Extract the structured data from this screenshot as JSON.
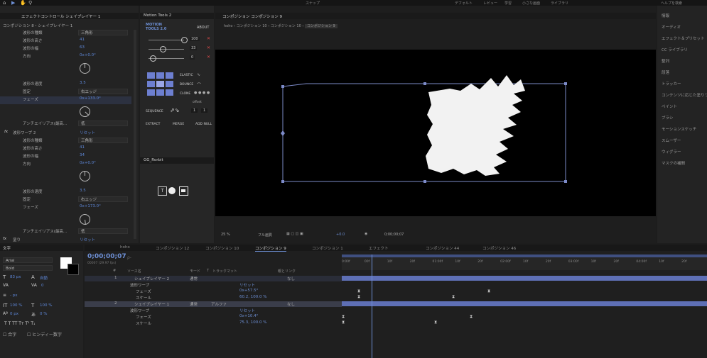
{
  "top_toolbar": {
    "left_icons": [
      "home-icon",
      "select-arrow-icon",
      "hand-icon",
      "zoom-icon"
    ],
    "mid_label": "スナップ",
    "right_tabs": [
      "デフォルト",
      "レビュー",
      "学習",
      "小さな画面",
      "ライブラリ"
    ],
    "search_placeholder": "ヘルプを検索"
  },
  "effects_panel": {
    "tab_label": "エフェクトコントロール シェイプレイヤー 1",
    "subtitle": "コンポジション 8・シェイプレイヤー 1",
    "group1": [
      {
        "label": "波形の種類",
        "value": "三角形",
        "type": "dropdown"
      },
      {
        "label": "波形の高さ",
        "value": "41",
        "type": "value"
      },
      {
        "label": "波形の幅",
        "value": "63",
        "type": "value"
      },
      {
        "label": "方向",
        "value": "0x+0.0°",
        "type": "value"
      }
    ],
    "group1b": [
      {
        "label": "波形の速度",
        "value": "3.5",
        "type": "value"
      },
      {
        "label": "固定",
        "value": "右エッジ",
        "type": "dropdown"
      },
      {
        "label": "フェーズ",
        "value": "0x+133.0°",
        "type": "value"
      }
    ],
    "aa1": {
      "label": "アンチエイリアス(最高...",
      "value": "低"
    },
    "fx_title": "波形ワープ 2",
    "fx_reset": "リセット",
    "group2": [
      {
        "label": "波形の種類",
        "value": "三角形",
        "type": "dropdown"
      },
      {
        "label": "波形の高さ",
        "value": "41",
        "type": "value"
      },
      {
        "label": "波形の幅",
        "value": "34",
        "type": "value"
      },
      {
        "label": "方向",
        "value": "0x+0.0°",
        "type": "value"
      }
    ],
    "group2b": [
      {
        "label": "波形の速度",
        "value": "3.5",
        "type": "value"
      },
      {
        "label": "固定",
        "value": "右エッジ",
        "type": "dropdown"
      },
      {
        "label": "フェーズ",
        "value": "0x+173.0°",
        "type": "value"
      }
    ],
    "aa2": {
      "label": "アンチエイリアス(最高...",
      "value": "低"
    },
    "fx_bottom": "塗り",
    "fx_bottom_value": "リセット"
  },
  "motion_tools": {
    "tab_label": "Motion Tools 2",
    "logo_line1": "MOTION",
    "logo_line2": "TOOLS 2.0",
    "about": "ABOUT",
    "slider_values": [
      "100",
      "33",
      "0"
    ],
    "elastic": "ELASTIC",
    "bounce": "BOUNCE",
    "clone": "CLONE",
    "offset": "offset",
    "sequence": "SEQUENCE",
    "seq_values": [
      "1",
      "1"
    ],
    "extract": "EXTRACT",
    "merge": "MERGE",
    "add_null": "ADD NULL",
    "gg_tab": "GG_Rorbit"
  },
  "composition": {
    "tab_label": "コンポジション コンポジション 9",
    "breadcrumbs": [
      "hoho",
      "コンポジション 10",
      "コンポジション 10",
      "コンポジション 9"
    ],
    "zoom": "25 %",
    "quality": "フル画質",
    "timecode": "0;00;00;07",
    "exposure": "+0.0"
  },
  "right_panel": {
    "items": [
      "情報",
      "オーディオ",
      "エフェクト＆プリセット",
      "CC ライブラリ",
      "整列",
      "段落",
      "トラッカー",
      "コンテンツに応じた塗りつぶし",
      "ペイント",
      "ブラシ",
      "モーションスケッチ",
      "スムーザー",
      "ウィグラー",
      "マスクの補間"
    ]
  },
  "character_panel": {
    "tab_label": "文字",
    "font": "Arial",
    "style": "Bold",
    "size": "83 px",
    "leading": "自動",
    "tracking": "0",
    "stroke": "- px",
    "vscale": "100 %",
    "hscale": "100 %",
    "baseline": "0 px",
    "tsume": "0 %",
    "styles_row": "T  T  TT  Tт  T¹  T₁",
    "cb1": "合字",
    "cb2": "ヒンディー数字"
  },
  "timeline": {
    "tabs": [
      "hoho",
      "コンポジション 12",
      "コンポジション 10",
      "コンポジション 9",
      "コンポジション 1",
      "エフェクト",
      "コンポジション 44",
      "コンポジション 46"
    ],
    "active_tab_index": 3,
    "timecode": "0;00;00;07",
    "fps": "00007 (29.97 fps)",
    "columns": [
      "#",
      "ソース名",
      "モード",
      "T",
      "トラックマット",
      "親とリンク"
    ],
    "rows": [
      {
        "num": "1",
        "name": "シェイプレイヤー 2",
        "mode": "通常",
        "parent": "なし",
        "indent": 0,
        "kind": "layer"
      },
      {
        "num": "",
        "name": "波形ワープ",
        "mode": "",
        "parent": "",
        "indent": 1,
        "kind": "fx",
        "value": "リセット"
      },
      {
        "num": "",
        "name": "フェーズ",
        "mode": "",
        "parent": "",
        "indent": 2,
        "kind": "prop",
        "value": "0x+57.5°"
      },
      {
        "num": "",
        "name": "スケール",
        "mode": "",
        "parent": "",
        "indent": 2,
        "kind": "prop",
        "value": "60.2, 100.0 %"
      },
      {
        "num": "2",
        "name": "シェイプレイヤー 1",
        "mode": "通常",
        "matte": "アルファ",
        "parent": "なし",
        "indent": 0,
        "kind": "layer"
      },
      {
        "num": "",
        "name": "波形ワープ",
        "mode": "",
        "parent": "",
        "indent": 1,
        "kind": "fx",
        "value": "リセット"
      },
      {
        "num": "",
        "name": "フェーズ",
        "mode": "",
        "parent": "",
        "indent": 2,
        "kind": "prop",
        "value": "0x+10.4°"
      },
      {
        "num": "",
        "name": "スケール",
        "mode": "",
        "parent": "",
        "indent": 2,
        "kind": "prop",
        "value": "75.3, 100.0 %"
      }
    ],
    "ruler": [
      "0:00f",
      "00f",
      "10f",
      "20f",
      "01:00f",
      "10f",
      "20f",
      "02:00f",
      "10f",
      "20f",
      "03:00f",
      "10f",
      "20f",
      "04:00f",
      "10f",
      "20f"
    ]
  }
}
